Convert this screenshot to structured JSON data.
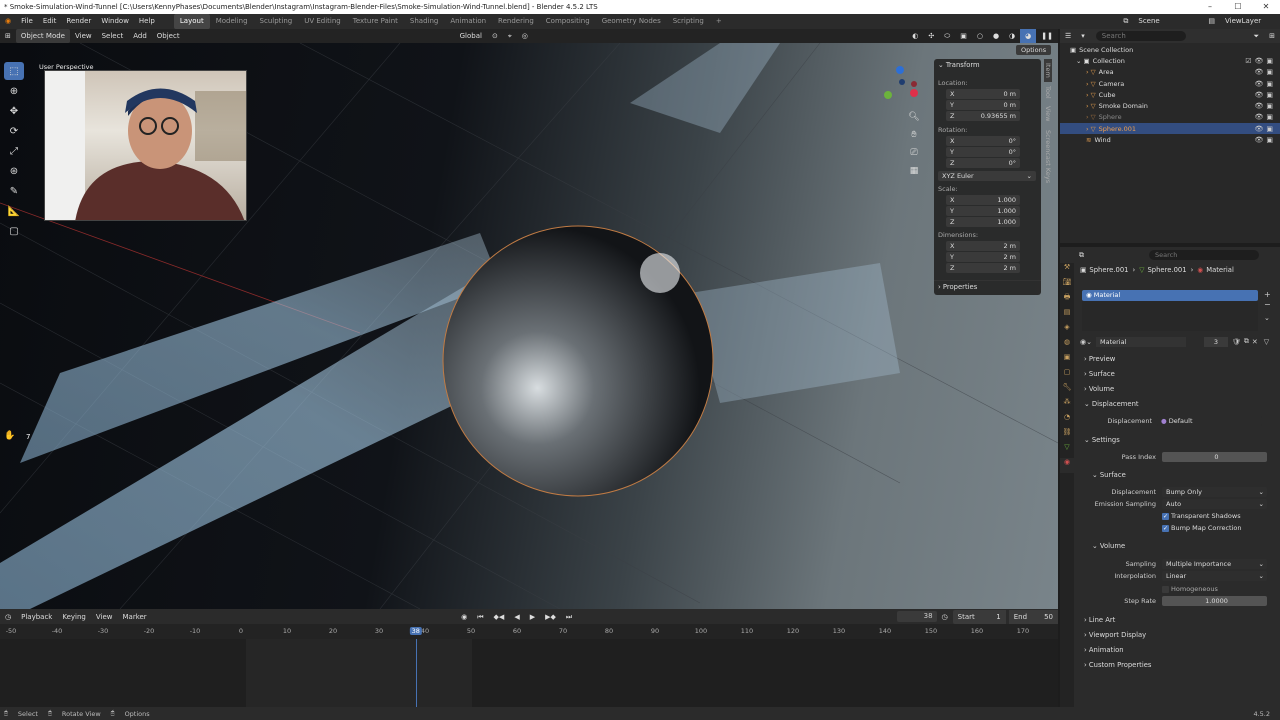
{
  "title": "* Smoke-Simulation-Wind-Tunnel [C:\\Users\\KennyPhases\\Documents\\Blender\\Instagram\\Instagram-Blender-Files\\Smoke-Simulation-Wind-Tunnel.blend] - Blender 4.5.2 LTS",
  "menu": [
    "File",
    "Edit",
    "Render",
    "Window",
    "Help"
  ],
  "workspaces": [
    "Layout",
    "Modeling",
    "Sculpting",
    "UV Editing",
    "Texture Paint",
    "Shading",
    "Animation",
    "Rendering",
    "Compositing",
    "Geometry Nodes",
    "Scripting"
  ],
  "active_workspace": "Layout",
  "scene": "Scene",
  "view_layer": "ViewLayer",
  "viewport_header": {
    "mode": "Object Mode",
    "menus": [
      "View",
      "Select",
      "Add",
      "Object"
    ],
    "orientation": "Global",
    "options": "Options"
  },
  "viewport": {
    "perspective": "User Perspective",
    "hand_count": "7"
  },
  "npanel": {
    "transform": "Transform",
    "location_label": "Location:",
    "location": {
      "x": "0 m",
      "y": "0 m",
      "z": "0.93655 m"
    },
    "rotation_label": "Rotation:",
    "rotation": {
      "x": "0°",
      "y": "0°",
      "z": "0°"
    },
    "rotation_mode": "XYZ Euler",
    "scale_label": "Scale:",
    "scale": {
      "x": "1.000",
      "y": "1.000",
      "z": "1.000"
    },
    "dimensions_label": "Dimensions:",
    "dimensions": {
      "x": "2 m",
      "y": "2 m",
      "z": "2 m"
    },
    "properties": "Properties",
    "tabs": [
      "Item",
      "Tool",
      "View",
      "Screencast Keys"
    ]
  },
  "outliner": {
    "search": "Search",
    "root": "Scene Collection",
    "collection": "Collection",
    "items": [
      "Area",
      "Camera",
      "Cube",
      "Smoke Domain",
      "Sphere",
      "Sphere.001",
      "Wind"
    ]
  },
  "properties": {
    "search": "Search",
    "breadcrumb": [
      "Sphere.001",
      "Sphere.001",
      "Material"
    ],
    "slot": "Material",
    "material_name": "Material",
    "users": "3",
    "sections": {
      "preview": "Preview",
      "surface": "Surface",
      "volume": "Volume",
      "displacement": "Displacement",
      "settings": "Settings",
      "line_art": "Line Art",
      "viewport_display": "Viewport Display",
      "animation": "Animation",
      "custom_properties": "Custom Properties"
    },
    "displacement_label": "Displacement",
    "displacement_value": "Default",
    "pass_index_label": "Pass Index",
    "pass_index": "0",
    "surface_sub": "Surface",
    "surf_displacement_label": "Displacement",
    "surf_displacement": "Bump Only",
    "emission_label": "Emission Sampling",
    "emission": "Auto",
    "transparent_shadows": "Transparent Shadows",
    "bump_map": "Bump Map Correction",
    "volume_sub": "Volume",
    "sampling_label": "Sampling",
    "sampling": "Multiple Importance",
    "interp_label": "Interpolation",
    "interp": "Linear",
    "homogeneous": "Homogeneous",
    "step_label": "Step Rate",
    "step": "1.0000"
  },
  "timeline": {
    "menus": [
      "Playback",
      "Keying",
      "View",
      "Marker"
    ],
    "current": "38",
    "start_label": "Start",
    "start": "1",
    "end_label": "End",
    "end": "50",
    "ticks": [
      "-50",
      "-40",
      "-30",
      "-20",
      "-10",
      "0",
      "10",
      "20",
      "30",
      "40",
      "50",
      "60",
      "70",
      "80",
      "90",
      "100",
      "110",
      "120",
      "130",
      "140",
      "150",
      "160",
      "170"
    ]
  },
  "status": {
    "select": "Select",
    "rotate": "Rotate View",
    "options": "Options",
    "version": "4.5.2"
  }
}
